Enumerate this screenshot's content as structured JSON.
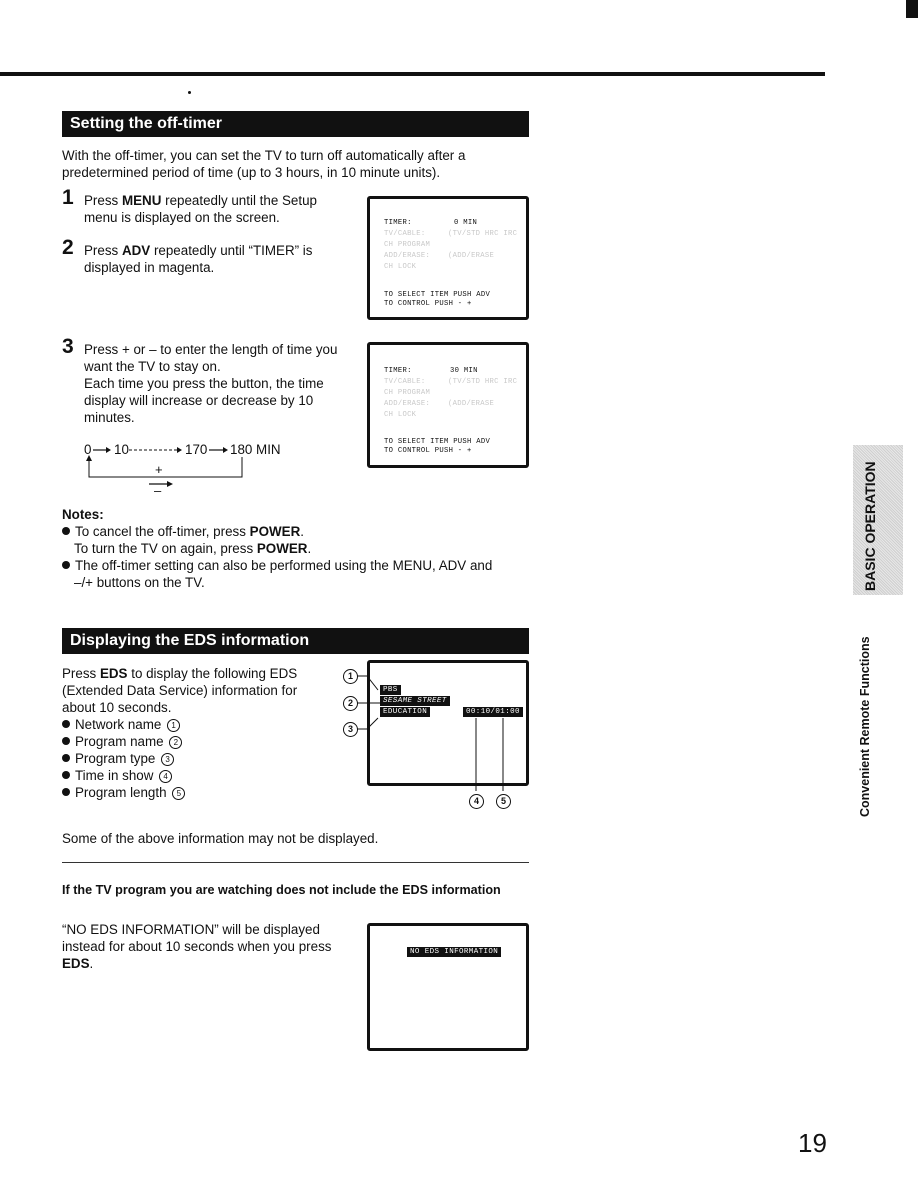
{
  "page": {
    "page_number": "19",
    "side_tab": "BASIC OPERATION",
    "side_label": "Convenient Remote Functions"
  },
  "off_timer": {
    "title": "Setting the off-timer",
    "intro_line1": "With the off-timer, you can set the TV to turn off automatically after a",
    "intro_line2": "predetermined period of time (up to 3 hours, in 10 minute units).",
    "steps": [
      {
        "num": "1",
        "pre": "Press ",
        "key": "MENU",
        "post": " repeatedly until the Setup menu is displayed on the screen."
      },
      {
        "num": "2",
        "pre": "Press ",
        "key": "ADV",
        "post": " repeatedly until “TIMER” is displayed in magenta."
      },
      {
        "num": "3",
        "line1": "Press + or – to enter the length of time you want the TV to stay on.",
        "line2": "Each time you press the button, the time display will increase or decrease by 10 minutes."
      }
    ],
    "sequence": {
      "v0": "0",
      "v1": "10",
      "v2": "170",
      "v3": "180 MIN",
      "plus": "+",
      "minus": "–"
    },
    "screen1": {
      "timer_label": "TIMER:",
      "timer_value": "0 MIN",
      "dim_lines": [
        {
          "left": "TV/CABLE:",
          "right": "(TV/STD HRC IRC"
        },
        {
          "left": "CH PROGRAM",
          "right": ""
        },
        {
          "left": "ADD/ERASE:",
          "right": "(ADD/ERASE"
        },
        {
          "left": "CH LOCK",
          "right": ""
        }
      ],
      "help1": "TO SELECT ITEM PUSH ADV",
      "help2": "TO CONTROL PUSH - +"
    },
    "screen2": {
      "timer_label": "TIMER:",
      "timer_value": "30 MIN",
      "dim_lines": [
        {
          "left": "TV/CABLE:",
          "right": "(TV/STD HRC IRC"
        },
        {
          "left": "CH PROGRAM",
          "right": ""
        },
        {
          "left": "ADD/ERASE:",
          "right": "(ADD/ERASE"
        },
        {
          "left": "CH LOCK",
          "right": ""
        }
      ],
      "help1": "TO SELECT ITEM PUSH ADV",
      "help2": "TO CONTROL PUSH - +"
    },
    "notes": {
      "title": "Notes:",
      "n1_pre": "To cancel the off-timer, press ",
      "n1_key": "POWER",
      "n1b_pre": "To turn the TV on again, press ",
      "n1b_key": "POWER",
      "n2_line1": "The off-timer setting can also be performed using the MENU, ADV and",
      "n2_line2": "–/+ buttons on the TV."
    }
  },
  "eds": {
    "title": "Displaying the EDS information",
    "intro_pre": "Press ",
    "intro_key": "EDS",
    "intro_post1": " to display the following EDS",
    "intro_line2": "(Extended Data Service) information for",
    "intro_line3": "about 10 seconds.",
    "items": [
      {
        "label": "Network name",
        "num": "1"
      },
      {
        "label": "Program name",
        "num": "2"
      },
      {
        "label": "Program type",
        "num": "3"
      },
      {
        "label": "Time in show",
        "num": "4"
      },
      {
        "label": "Program length",
        "num": "5"
      }
    ],
    "screen": {
      "network": "PBS",
      "program": "SESAME STREET",
      "type": "EDUCATION",
      "time": "00:10/01:00"
    },
    "footnote": "Some of the above information may not be displayed.",
    "sub_heading": "If the TV program you are watching does not include the EDS information",
    "no_eds_line1": "“NO EDS INFORMATION” will be displayed",
    "no_eds_line2": "instead for about 10 seconds when you press",
    "no_eds_key": "EDS",
    "no_eds_screen": "NO EDS INFORMATION"
  }
}
